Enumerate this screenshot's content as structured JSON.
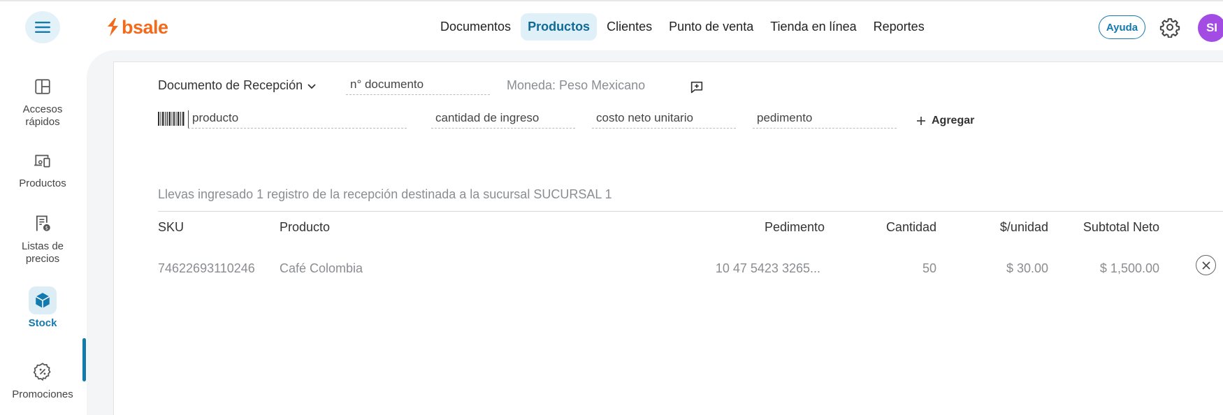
{
  "header": {
    "logo_text": "bsale",
    "nav": [
      "Documentos",
      "Productos",
      "Clientes",
      "Punto de venta",
      "Tienda en línea",
      "Reportes"
    ],
    "active_nav_index": 1,
    "help_label": "Ayuda",
    "avatar_initials": "SI",
    "icons": {
      "menu": "hamburger-menu-icon",
      "settings": "gear-icon"
    }
  },
  "sidebar": {
    "items": [
      {
        "label": "Accesos rápidos",
        "icon": "layout-grid-icon"
      },
      {
        "label": "Productos",
        "icon": "devices-icon"
      },
      {
        "label": "Listas de precios",
        "icon": "price-list-icon"
      },
      {
        "label": "Stock",
        "icon": "box-icon",
        "active": true
      },
      {
        "label": "Promociones",
        "icon": "discount-badge-icon"
      }
    ]
  },
  "form": {
    "document_type": "Documento de Recepción",
    "document_number_placeholder": "n° documento",
    "currency": "Moneda: Peso Mexicano",
    "product_placeholder": "producto",
    "quantity_placeholder": "cantidad de ingreso",
    "cost_placeholder": "costo neto unitario",
    "pedimento_placeholder": "pedimento",
    "add_label": "Agregar"
  },
  "summary": "Llevas ingresado 1 registro de la recepción destinada a la sucursal SUCURSAL 1",
  "table": {
    "headers": [
      "SKU",
      "Producto",
      "Pedimento",
      "Cantidad",
      "$/unidad",
      "Subtotal Neto"
    ],
    "rows": [
      [
        "74622693110246",
        "Café Colombia",
        "10 47 5423 3265...",
        "50",
        "$ 30.00",
        "$ 1,500.00"
      ]
    ]
  },
  "colors": {
    "brand": "#f26b1d",
    "accent": "#1479ad",
    "avatar": "#a24ce3"
  }
}
